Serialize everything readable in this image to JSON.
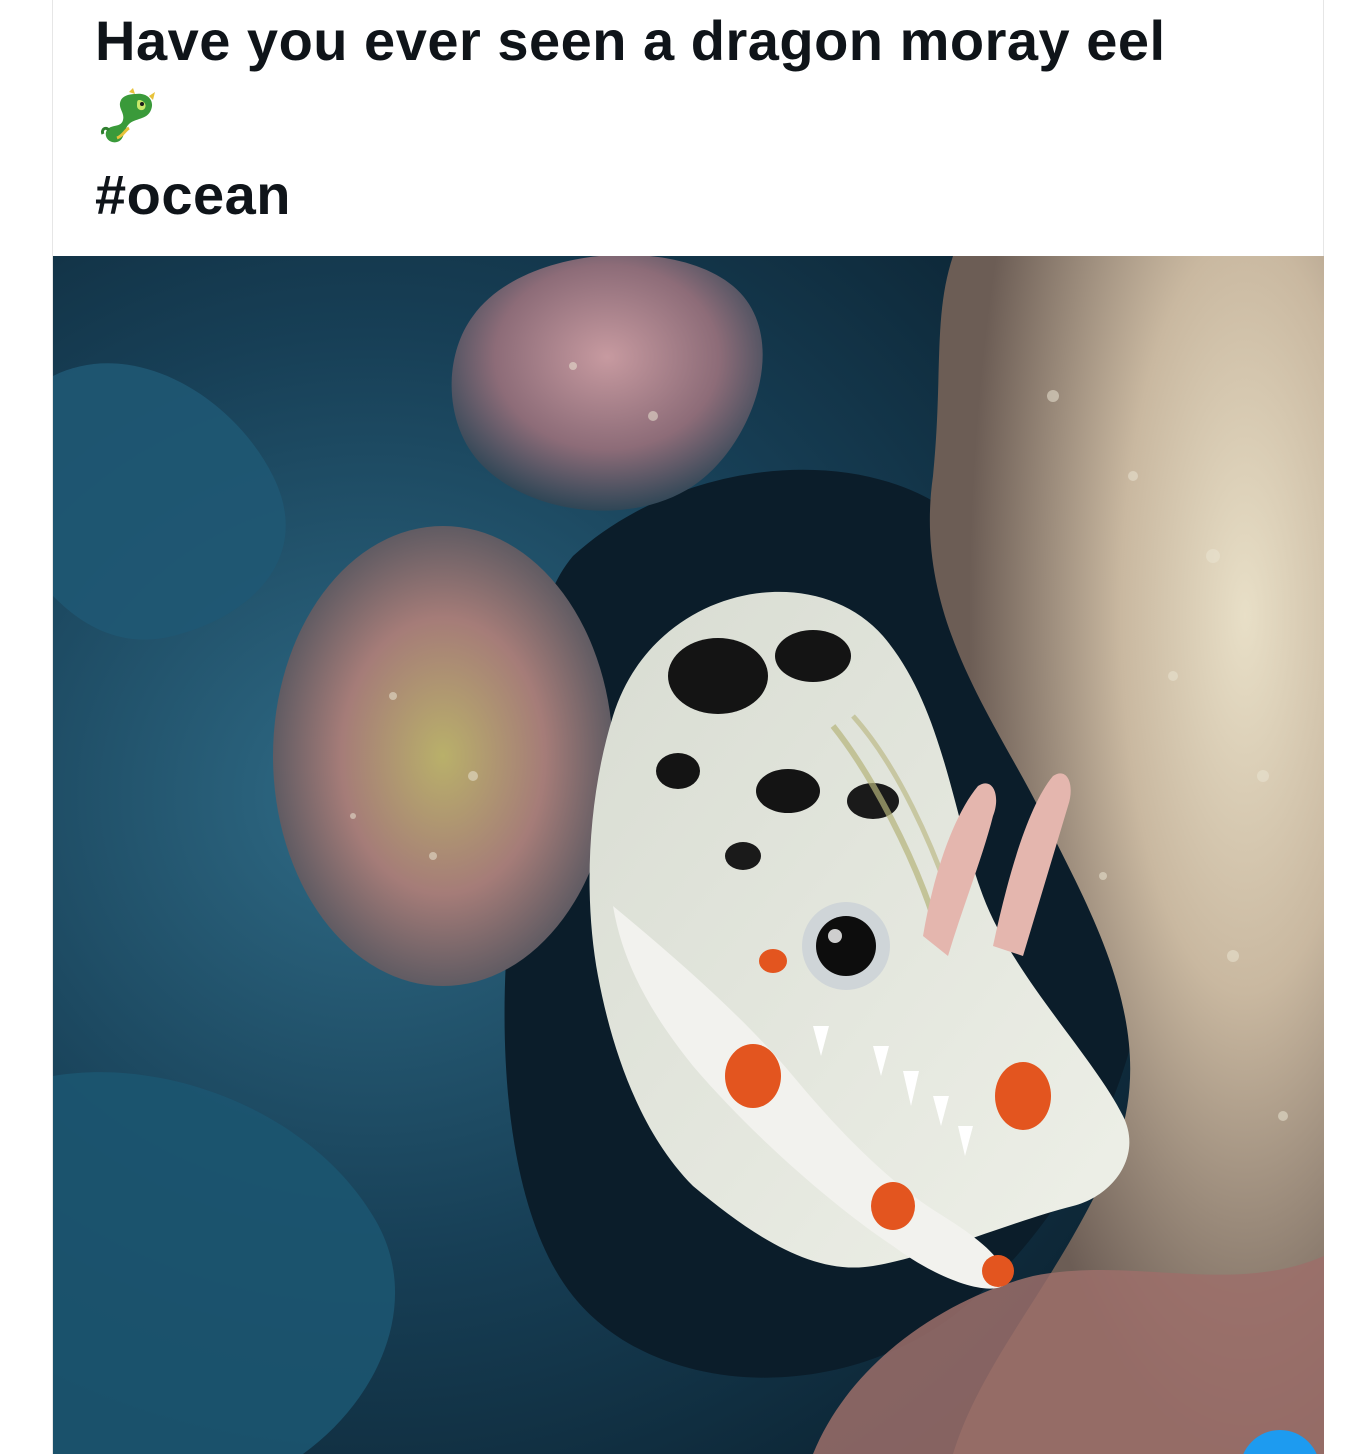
{
  "tweet": {
    "line1": "Have you ever seen a dragon moray eel",
    "emoji": "dragon-emoji",
    "hashtag": "#ocean"
  },
  "media": {
    "type": "photo",
    "subject": "dragon-moray-eel-photo"
  },
  "colors": {
    "text": "#0f1419",
    "accent": "#1d9bf0",
    "border": "#e6e6e6"
  }
}
